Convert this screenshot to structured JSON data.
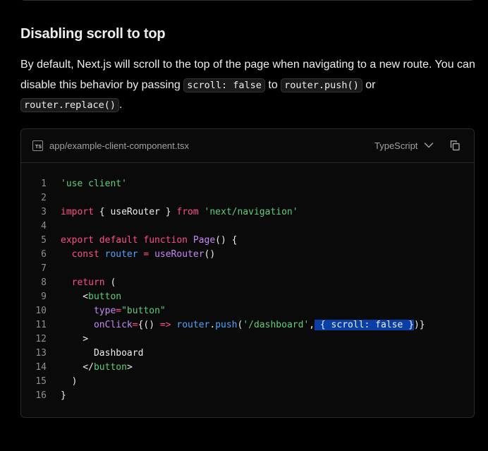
{
  "section": {
    "title": "Disabling scroll to top",
    "para": {
      "text1": "By default, Next.js will scroll to the top of the page when navigating to a new route. You can disable this behavior by passing ",
      "code1": "scroll: false",
      "text2": " to ",
      "code2": "router.push()",
      "text3": " or ",
      "code3": "router.replace()",
      "text4": "."
    }
  },
  "codeblock": {
    "file_icon": "TS",
    "filename": "app/example-client-component.tsx",
    "language": "TypeScript",
    "lines": [
      {
        "n": "1",
        "t": [
          {
            "s": "'use client'",
            "c": "str"
          }
        ]
      },
      {
        "n": "2",
        "t": []
      },
      {
        "n": "3",
        "t": [
          {
            "s": "import",
            "c": "kw"
          },
          {
            "s": " { useRouter } ",
            "c": "pl"
          },
          {
            "s": "from",
            "c": "kw"
          },
          {
            "s": " ",
            "c": "pl"
          },
          {
            "s": "'next/navigation'",
            "c": "str"
          }
        ]
      },
      {
        "n": "4",
        "t": []
      },
      {
        "n": "5",
        "t": [
          {
            "s": "export default function",
            "c": "kw"
          },
          {
            "s": " ",
            "c": "pl"
          },
          {
            "s": "Page",
            "c": "fn"
          },
          {
            "s": "() {",
            "c": "pl"
          }
        ]
      },
      {
        "n": "6",
        "t": [
          {
            "s": "  ",
            "c": "pl"
          },
          {
            "s": "const",
            "c": "kw"
          },
          {
            "s": " ",
            "c": "pl"
          },
          {
            "s": "router",
            "c": "var"
          },
          {
            "s": " ",
            "c": "pl"
          },
          {
            "s": "=",
            "c": "kw"
          },
          {
            "s": " ",
            "c": "pl"
          },
          {
            "s": "useRouter",
            "c": "fn"
          },
          {
            "s": "()",
            "c": "pl"
          }
        ]
      },
      {
        "n": "7",
        "t": []
      },
      {
        "n": "8",
        "t": [
          {
            "s": "  ",
            "c": "pl"
          },
          {
            "s": "return",
            "c": "kw"
          },
          {
            "s": " (",
            "c": "pl"
          }
        ]
      },
      {
        "n": "9",
        "t": [
          {
            "s": "    <",
            "c": "pl"
          },
          {
            "s": "button",
            "c": "str"
          }
        ]
      },
      {
        "n": "10",
        "t": [
          {
            "s": "      ",
            "c": "pl"
          },
          {
            "s": "type",
            "c": "fn"
          },
          {
            "s": "=",
            "c": "kw"
          },
          {
            "s": "\"button\"",
            "c": "str"
          }
        ]
      },
      {
        "n": "11",
        "t": [
          {
            "s": "      ",
            "c": "pl"
          },
          {
            "s": "onClick",
            "c": "fn"
          },
          {
            "s": "=",
            "c": "kw"
          },
          {
            "s": "{() ",
            "c": "pl"
          },
          {
            "s": "=>",
            "c": "kw"
          },
          {
            "s": " ",
            "c": "pl"
          },
          {
            "s": "router",
            "c": "var"
          },
          {
            "s": ".",
            "c": "pl"
          },
          {
            "s": "push",
            "c": "var"
          },
          {
            "s": "(",
            "c": "pl"
          },
          {
            "s": "'/dashboard'",
            "c": "str"
          },
          {
            "s": ",",
            "c": "pl"
          },
          {
            "s": " { scroll: false }",
            "c": "hl"
          },
          {
            "s": ")}",
            "c": "pl"
          }
        ]
      },
      {
        "n": "12",
        "t": [
          {
            "s": "    >",
            "c": "pl"
          }
        ]
      },
      {
        "n": "13",
        "t": [
          {
            "s": "      Dashboard",
            "c": "pl"
          }
        ]
      },
      {
        "n": "14",
        "t": [
          {
            "s": "    </",
            "c": "pl"
          },
          {
            "s": "button",
            "c": "str"
          },
          {
            "s": ">",
            "c": "pl"
          }
        ]
      },
      {
        "n": "15",
        "t": [
          {
            "s": "  )",
            "c": "pl"
          }
        ]
      },
      {
        "n": "16",
        "t": [
          {
            "s": "}",
            "c": "pl"
          }
        ]
      }
    ]
  },
  "icons": {
    "file": "typescript-file-icon",
    "chevron": "chevron-down-icon",
    "copy": "copy-icon"
  }
}
